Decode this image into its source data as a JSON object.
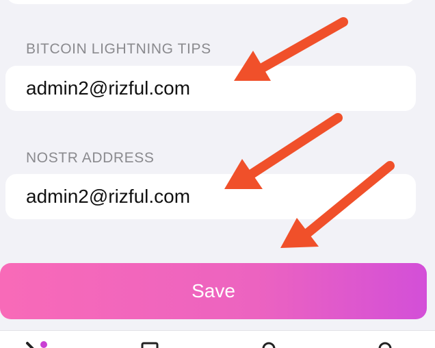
{
  "lightning": {
    "label": "BITCOIN LIGHTNING TIPS",
    "value": "admin2@rizful.com"
  },
  "nostr": {
    "label": "NOSTR ADDRESS",
    "value": "admin2@rizful.com"
  },
  "save_button": {
    "label": "Save"
  },
  "colors": {
    "background": "#f2f2f7",
    "arrow": "#f0502a",
    "save_gradient_start": "#f86ab8",
    "save_gradient_end": "#d34fd8"
  },
  "tab_bar": {
    "icons": [
      "back-arrow-icon",
      "square-icon",
      "profile-icon",
      "search-icon"
    ]
  }
}
